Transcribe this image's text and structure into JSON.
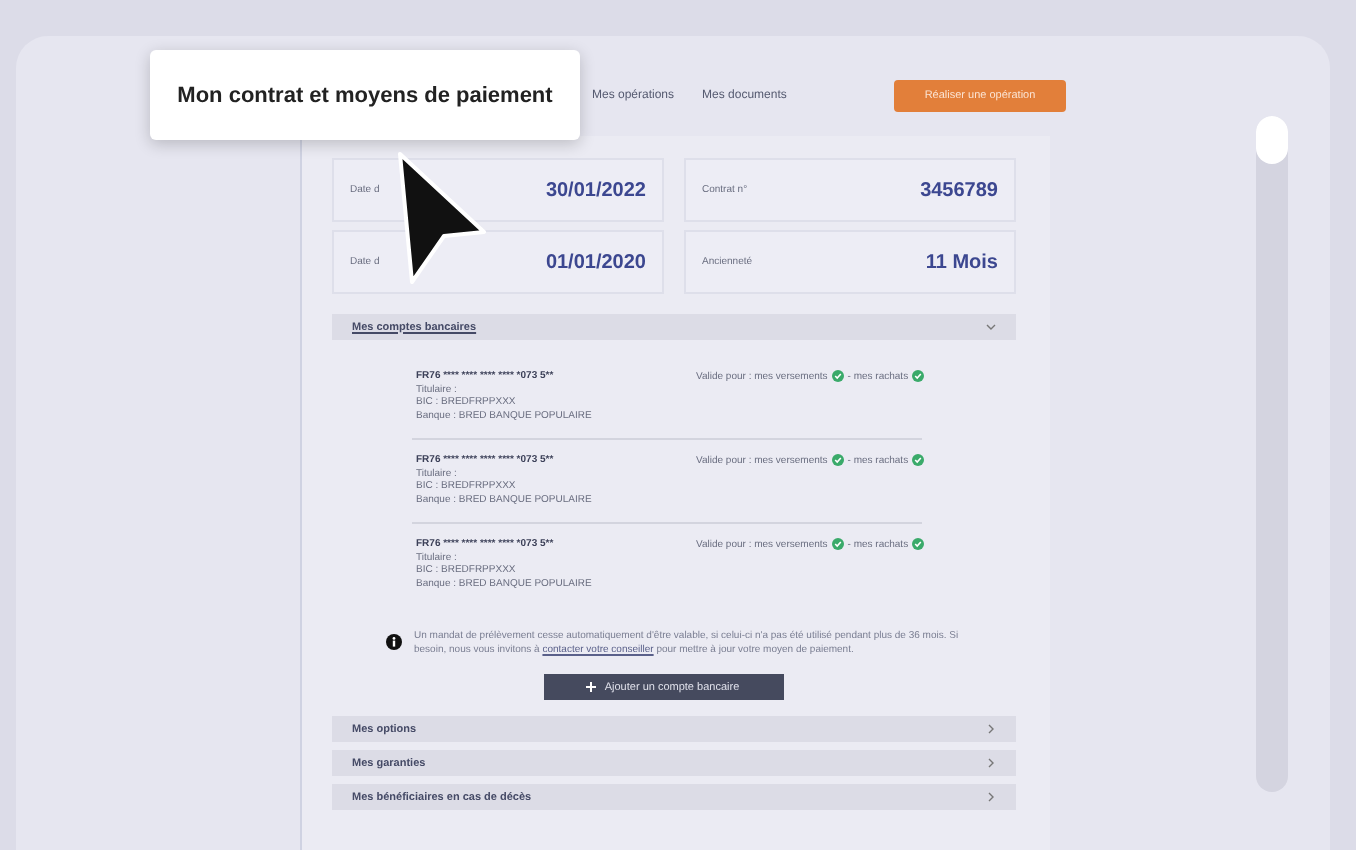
{
  "tooltip": {
    "text": "Mon contrat et moyens de paiement"
  },
  "tabs": [
    {
      "label": "Mes opérations",
      "selected": false
    },
    {
      "label": "Mes documents",
      "selected": false
    }
  ],
  "action_button": "Réaliser une opération",
  "summary": [
    {
      "label": "Date d",
      "value": "30/01/2022"
    },
    {
      "label": "Contrat n°",
      "value": "3456789"
    },
    {
      "label": "Date d",
      "value": "01/01/2020"
    },
    {
      "label": "Ancienneté",
      "value": "11 Mois"
    }
  ],
  "bank_section": {
    "title": "Mes comptes bancaires",
    "expanded": true,
    "accounts": [
      {
        "iban": "FR76 **** **** **** **** *073 5**",
        "holder": "Titulaire :",
        "bic": "BIC : BREDFRPPXXX",
        "bank": "Banque : BRED BANQUE POPULAIRE",
        "validity": "Valide pour : mes versements",
        "validity_end": "- mes rachats"
      },
      {
        "iban": "FR76 **** **** **** **** *073 5**",
        "holder": "Titulaire :",
        "bic": "BIC : BREDFRPPXXX",
        "bank": "Banque : BRED BANQUE POPULAIRE",
        "validity": "Valide pour : mes versements",
        "validity_end": "- mes rachats"
      },
      {
        "iban": "FR76 **** **** **** **** *073 5**",
        "holder": "Titulaire :",
        "bic": "BIC : BREDFRPPXXX",
        "bank": "Banque : BRED BANQUE POPULAIRE",
        "validity": "Valide pour : mes versements",
        "validity_end": "- mes rachats"
      }
    ]
  },
  "note": {
    "text": "Un mandat de prélèvement cesse automatiquement d'être valable, si celui-ci n'a pas été utilisé pendant plus de 36 mois. Si besoin, nous vous invitons à",
    "link": "contacter votre conseiller",
    "text_after": "pour mettre à jour votre moyen de paiement."
  },
  "add_button": "Ajouter un compte bancaire",
  "sections": [
    {
      "title": "Mes options",
      "expanded": false
    },
    {
      "title": "Mes garanties",
      "expanded": false
    },
    {
      "title": "Mes bénéficiaires en cas de décès",
      "expanded": false
    }
  ]
}
